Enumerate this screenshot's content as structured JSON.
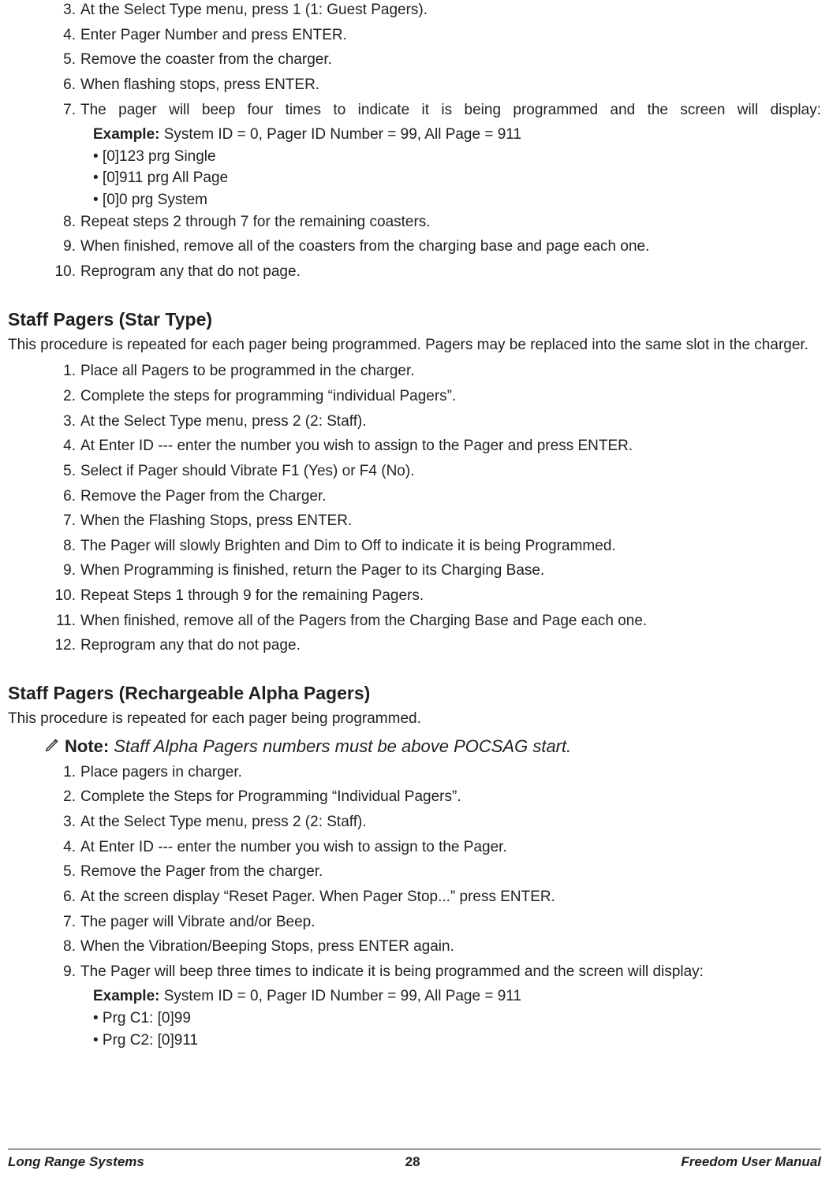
{
  "listA": {
    "items": [
      {
        "n": "3.",
        "t": "At the Select Type menu, press 1 (1: Guest Pagers)."
      },
      {
        "n": "4.",
        "t": "Enter Pager Number and press ENTER."
      },
      {
        "n": "5.",
        "t": "Remove the coaster from the charger."
      },
      {
        "n": "6.",
        "t": "When flashing stops, press ENTER."
      }
    ],
    "item7": {
      "n": "7.",
      "line1": "The pager will beep four times to indicate it is being programmed and the screen will display:",
      "exampleLabel": "Example:",
      "exampleText": " System ID = 0, Pager ID Number = 99, All Page = 911",
      "bullets": [
        "• [0]123 prg Single",
        "• [0]911 prg All Page",
        "• [0]0 prg System"
      ]
    },
    "tail": [
      {
        "n": "8.",
        "t": "Repeat steps 2 through 7 for the remaining coasters."
      },
      {
        "n": "9.",
        "t": "When finished, remove all of the coasters from the charging base and page each one."
      },
      {
        "n": "10.",
        "t": "Reprogram any that do not page."
      }
    ]
  },
  "sectionB": {
    "title": "Staff Pagers (Star Type)",
    "intro": "This procedure is repeated for each pager being programmed. Pagers may be replaced into the same slot in the charger.",
    "items": [
      {
        "n": "1.",
        "t": "Place all Pagers to be programmed in the charger."
      },
      {
        "n": "2.",
        "t": "Complete the steps for programming “individual Pagers”."
      },
      {
        "n": "3.",
        "t": "At the Select Type menu, press 2 (2: Staff)."
      },
      {
        "n": "4.",
        "t": "At Enter ID --- enter the number you wish to assign to the Pager and press ENTER."
      },
      {
        "n": "5.",
        "t": "Select if Pager should Vibrate F1 (Yes) or F4 (No)."
      },
      {
        "n": "6.",
        "t": "Remove the Pager from the Charger."
      },
      {
        "n": "7.",
        "t": "When the Flashing Stops, press ENTER."
      },
      {
        "n": "8.",
        "t": "The Pager will slowly Brighten and Dim to Off to indicate it is being Programmed."
      },
      {
        "n": "9.",
        "t": "When Programming is finished, return the Pager to its Charging Base."
      },
      {
        "n": "10.",
        "t": "Repeat Steps 1 through 9 for the remaining Pagers."
      },
      {
        "n": "11.",
        "t": "When finished, remove all of the Pagers from the Charging Base and Page each one."
      },
      {
        "n": "12.",
        "t": "Reprogram any that do not page."
      }
    ]
  },
  "sectionC": {
    "title": "Staff Pagers (Rechargeable Alpha Pagers)",
    "intro": "This procedure is repeated for each pager being programmed.",
    "noteLabel": "Note:",
    "noteText": " Staff Alpha Pagers numbers must be above POCSAG start.",
    "items": [
      {
        "n": "1.",
        "t": "Place pagers in charger."
      },
      {
        "n": "2.",
        "t": "Complete the Steps for Programming “Individual Pagers”."
      },
      {
        "n": "3.",
        "t": "At the Select Type menu, press 2 (2: Staff)."
      },
      {
        "n": "4.",
        "t": "At Enter ID --- enter the number you wish to assign to the Pager."
      },
      {
        "n": "5.",
        "t": "Remove the Pager from the charger."
      },
      {
        "n": "6.",
        "t": "At the screen display “Reset Pager. When Pager Stop...” press ENTER."
      },
      {
        "n": "7.",
        "t": "The pager will Vibrate and/or Beep."
      },
      {
        "n": "8.",
        "t": "When the Vibration/Beeping Stops, press ENTER again."
      }
    ],
    "item9": {
      "n": "9.",
      "line1": "The Pager will beep three times to indicate it is being programmed and the screen will display:",
      "exampleLabel": "Example:",
      "exampleText": " System ID = 0, Pager ID Number = 99, All Page = 911",
      "bullets": [
        "• Prg C1: [0]99",
        "• Prg C2: [0]911"
      ]
    }
  },
  "footer": {
    "left": "Long Range Systems",
    "center": "28",
    "right": "Freedom User Manual"
  }
}
